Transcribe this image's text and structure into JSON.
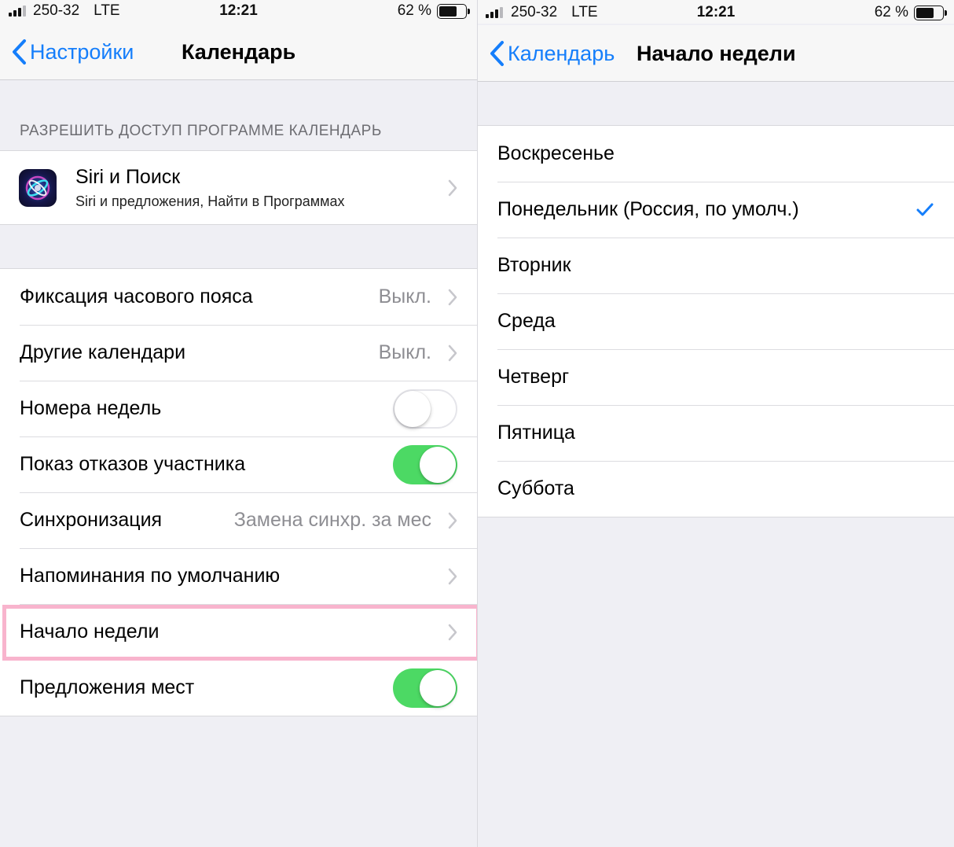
{
  "status_left": {
    "carrier": "250-32",
    "network": "LTE",
    "time": "12:21",
    "battery_pct": "62 %",
    "battery_level": 0.62
  },
  "status_right": {
    "carrier": "250-32",
    "network": "LTE",
    "time": "12:21",
    "battery_pct": "62 %",
    "battery_level": 0.62
  },
  "left": {
    "back_label": "Настройки",
    "title": "Календарь",
    "section_header": "РАЗРЕШИТЬ ДОСТУП ПРОГРАММЕ КАЛЕНДАРЬ",
    "siri": {
      "title": "Siri и Поиск",
      "subtitle": "Siri и предложения, Найти в Программах"
    },
    "rows": [
      {
        "label": "Фиксация часового пояса",
        "value": "Выкл."
      },
      {
        "label": "Другие календари",
        "value": "Выкл."
      },
      {
        "label": "Номера недель",
        "toggle": false
      },
      {
        "label": "Показ отказов участника",
        "toggle": true
      },
      {
        "label": "Синхронизация",
        "value": "Замена синхр. за мес"
      },
      {
        "label": "Напоминания по умолчанию",
        "value": ""
      },
      {
        "label": "Начало недели",
        "value": ""
      },
      {
        "label": "Предложения мест",
        "toggle": true
      }
    ]
  },
  "right": {
    "back_label": "Календарь",
    "title": "Начало недели",
    "days": [
      {
        "label": "Воскресенье",
        "selected": false
      },
      {
        "label": "Понедельник (Россия, по умолч.)",
        "selected": true
      },
      {
        "label": "Вторник",
        "selected": false
      },
      {
        "label": "Среда",
        "selected": false
      },
      {
        "label": "Четверг",
        "selected": false
      },
      {
        "label": "Пятница",
        "selected": false
      },
      {
        "label": "Суббота",
        "selected": false
      }
    ]
  },
  "colors": {
    "accent": "#157efb",
    "toggle_on": "#4cd964",
    "highlight": "#f8b4cd",
    "background": "#efeff4"
  },
  "icons": {
    "back": "chevron-left-icon",
    "disclosure": "chevron-right-icon",
    "selected": "checkmark-icon",
    "siri": "siri-icon"
  }
}
